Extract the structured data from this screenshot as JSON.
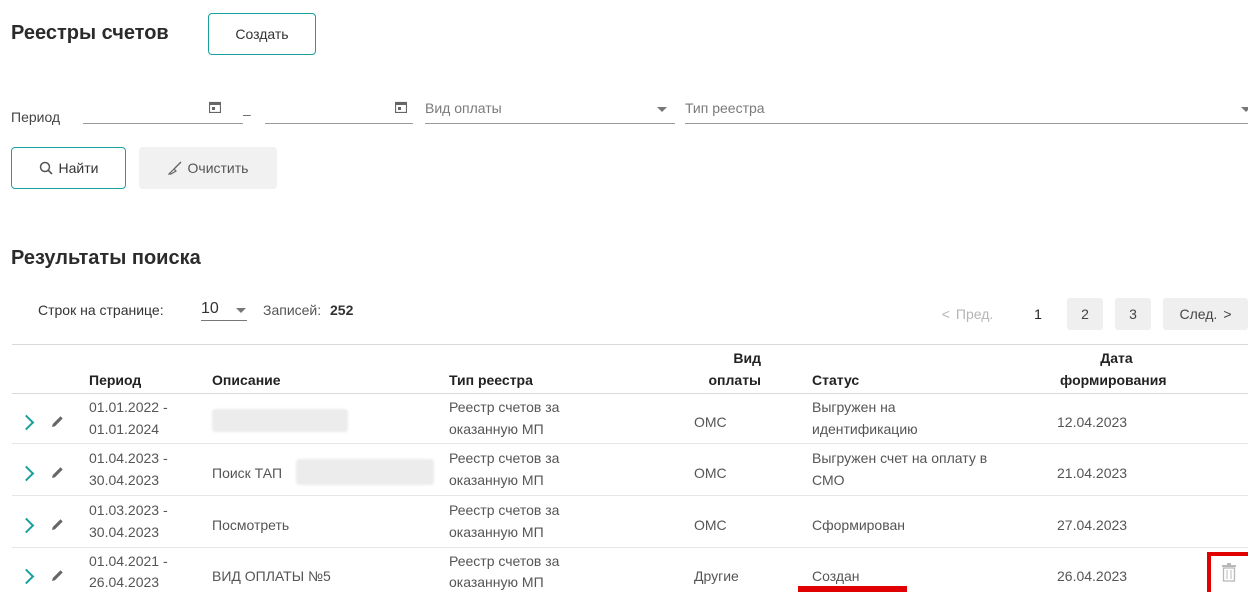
{
  "header": {
    "title": "Реестры счетов",
    "create_label": "Создать"
  },
  "filters": {
    "period_label": "Период",
    "dash": "–",
    "payment_type_placeholder": "Вид оплаты",
    "registry_type_placeholder": "Тип реестра",
    "find_label": "Найти",
    "clear_label": "Очистить"
  },
  "results": {
    "title": "Результаты поиска",
    "rows_per_page_label": "Строк на странице:",
    "rows_per_page_value": "10",
    "records_label": "Записей:",
    "records_count": "252"
  },
  "pagination": {
    "prev": "Пред.",
    "pages": [
      "1",
      "2",
      "3"
    ],
    "next": "След.",
    "active": "1"
  },
  "table": {
    "columns": {
      "period": "Период",
      "description": "Описание",
      "registry_type": "Тип реестра",
      "payment_type_1": "Вид",
      "payment_type_2": "оплаты",
      "status": "Статус",
      "date_1": "Дата",
      "date_2": "формирования"
    },
    "rows": [
      {
        "period_1": "01.01.2022 -",
        "period_2": "01.01.2024",
        "description": "",
        "type_1": "Реестр счетов за",
        "type_2": "оказанную МП",
        "payment": "ОМС",
        "status_1": "Выгружен на",
        "status_2": "идентификацию",
        "date": "12.04.2023"
      },
      {
        "period_1": "01.04.2023 -",
        "period_2": "30.04.2023",
        "description": "Поиск ТАП",
        "type_1": "Реестр счетов за",
        "type_2": "оказанную МП",
        "payment": "ОМС",
        "status_1": "Выгружен счет на оплату в",
        "status_2": "СМО",
        "date": "21.04.2023"
      },
      {
        "period_1": "01.03.2023 -",
        "period_2": "30.04.2023",
        "description": "Посмотреть",
        "type_1": "Реестр счетов за",
        "type_2": "оказанную МП",
        "payment": "ОМС",
        "status_1": "Сформирован",
        "status_2": "",
        "date": "27.04.2023"
      },
      {
        "period_1": "01.04.2021 -",
        "period_2": "26.04.2023",
        "description": "ВИД ОПЛАТЫ №5",
        "type_1": "Реестр счетов за",
        "type_2": "оказанную МП",
        "payment": "Другие",
        "status_1": "Создан",
        "status_2": "",
        "date": "26.04.2023"
      }
    ]
  },
  "colors": {
    "accent": "#1a9f9f",
    "highlight": "#e10000"
  },
  "icons": [
    "calendar-icon",
    "dropdown-caret-icon",
    "search-icon",
    "broom-icon",
    "chevron-right-icon",
    "pencil-icon",
    "trash-icon"
  ]
}
